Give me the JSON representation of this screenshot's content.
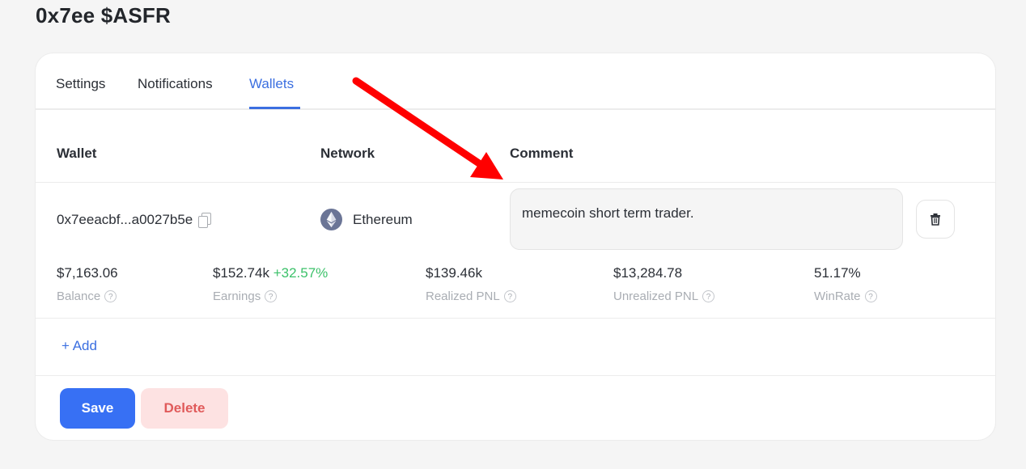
{
  "page": {
    "title": "0x7ee $ASFR"
  },
  "tabs": [
    {
      "label": "Settings",
      "active": false
    },
    {
      "label": "Notifications",
      "active": false
    },
    {
      "label": "Wallets",
      "active": true
    }
  ],
  "columns": {
    "wallet": "Wallet",
    "network": "Network",
    "comment": "Comment"
  },
  "wallet_row": {
    "address": "0x7eeacbf...a0027b5e",
    "network": "Ethereum",
    "comment": "memecoin short term trader."
  },
  "stats": [
    {
      "value": "$7,163.06",
      "label": "Balance"
    },
    {
      "value": "$152.74k",
      "pct": "+32.57%",
      "label": "Earnings"
    },
    {
      "value": "$139.46k",
      "label": "Realized PNL"
    },
    {
      "value": "$13,284.78",
      "label": "Unrealized PNL"
    },
    {
      "value": "51.17%",
      "label": "WinRate"
    }
  ],
  "help_glyph": "?",
  "actions": {
    "add": "+ Add",
    "save": "Save",
    "delete": "Delete"
  },
  "colors": {
    "accent": "#3b6fe0",
    "save": "#3770f4",
    "delete_bg": "#fde2e2",
    "delete_text": "#e05a5a",
    "positive": "#3cc16a",
    "annotation_arrow": "#ff0000"
  },
  "icons": {
    "copy": "copy-icon",
    "network": "ethereum-icon",
    "trash": "trash-icon",
    "help": "help-icon",
    "annotation": "red-arrow-annotation"
  }
}
